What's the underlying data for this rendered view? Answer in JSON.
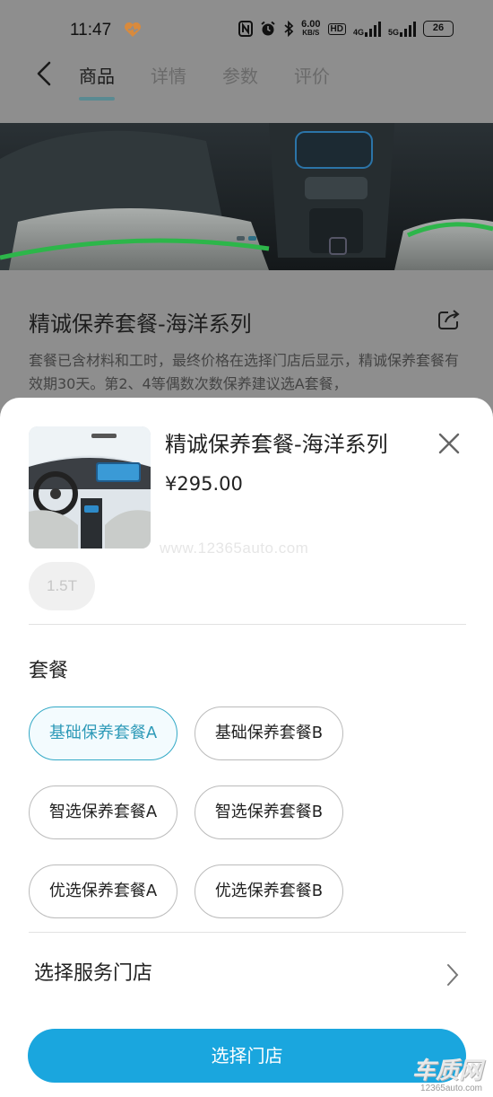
{
  "status_bar": {
    "time": "11:47",
    "speed_value": "6.00",
    "speed_unit": "KB/S",
    "hd_label": "HD",
    "net_4g": "4G",
    "net_5g": "5G",
    "battery": "26"
  },
  "header": {
    "tabs": [
      {
        "label": "商品",
        "active": true
      },
      {
        "label": "详情",
        "active": false
      },
      {
        "label": "参数",
        "active": false
      },
      {
        "label": "评价",
        "active": false
      }
    ]
  },
  "product": {
    "title": "精诚保养套餐-海洋系列",
    "description": "套餐已含材料和工时，最终价格在选择门店后显示，精诚保养套餐有效期30天。第2、4等偶数次数保养建议选A套餐，"
  },
  "sheet": {
    "title": "精诚保养套餐-海洋系列",
    "price": "¥295.00",
    "watermark": "www.12365auto.com",
    "spec_option": "1.5T",
    "package_label": "套餐",
    "packages": [
      {
        "label": "基础保养套餐A",
        "selected": true
      },
      {
        "label": "基础保养套餐B",
        "selected": false
      },
      {
        "label": "智选保养套餐A",
        "selected": false
      },
      {
        "label": "智选保养套餐B",
        "selected": false
      },
      {
        "label": "优选保养套餐A",
        "selected": false
      },
      {
        "label": "优选保养套餐B",
        "selected": false
      }
    ],
    "store_label": "选择服务门店",
    "cta_label": "选择门店"
  },
  "brand": {
    "main": "车质网",
    "sub": "12365auto.com"
  },
  "colors": {
    "accent": "#1aa6de",
    "selected_border": "#33a9c6",
    "overlay": "#8e8e8e"
  }
}
